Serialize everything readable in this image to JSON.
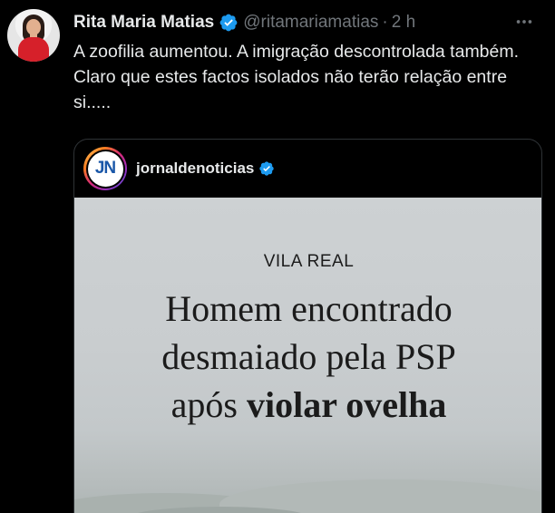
{
  "tweet": {
    "name": "Rita Maria Matias",
    "handle": "@ritamariamatias",
    "separator": "·",
    "time": "2 h",
    "text": "A zoofilia aumentou. A imigração descontrolada também. Claro que estes factos isolados não terão relação entre si.....",
    "more_icon": "more-horizontal-icon",
    "verified_icon": "verified-badge-icon"
  },
  "card": {
    "account": "jornaldenoticias",
    "logo_text": "JN",
    "kicker": "VILA REAL",
    "headline_line1": "Homem encontrado",
    "headline_line2": "desmaiado pela PSP",
    "headline_line3_prefix": "após ",
    "headline_line3_bold": "violar ovelha"
  },
  "colors": {
    "background": "#000000",
    "text_primary": "#e7e9ea",
    "text_secondary": "#71767b",
    "verified_blue": "#1d9bf0",
    "border": "#2f3336"
  }
}
